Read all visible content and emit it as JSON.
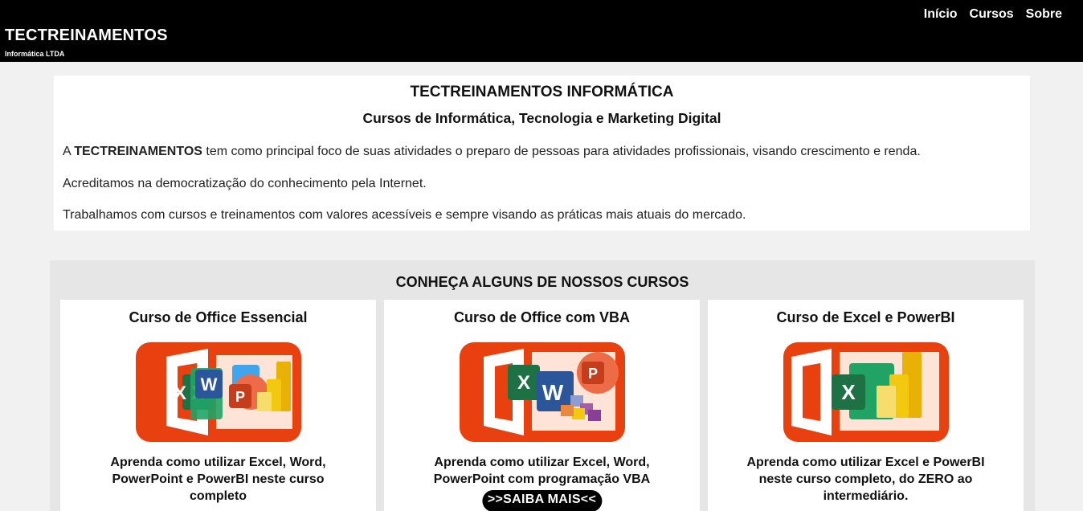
{
  "header": {
    "brand": "TECTREINAMENTOS",
    "brand_sub": "Informática LTDA",
    "nav": [
      "Início",
      "Cursos",
      "Sobre"
    ]
  },
  "intro": {
    "title": "TECTREINAMENTOS INFORMÁTICA",
    "subtitle": "Cursos de Informática, Tecnologia e Marketing Digital",
    "p1_prefix": "A ",
    "p1_bold": "TECTREINAMENTOS",
    "p1_rest": " tem como principal foco de suas atividades o preparo de pessoas para atividades profissionais, visando crescimento e renda.",
    "p2": "Acreditamos na democratização do conhecimento pela Internet.",
    "p3": "Trabalhamos com cursos e treinamentos com valores acessíveis e sempre visando as práticas mais atuais do mercado."
  },
  "courses": {
    "title": "CONHEÇA ALGUNS DE NOSSOS CURSOS",
    "items": [
      {
        "title": "Curso de Office Essencial",
        "desc": "Aprenda como utilizar Excel, Word, PowerPoint e PowerBI neste curso completo",
        "image_icon": "office-essencial-logo"
      },
      {
        "title": "Curso de Office com VBA",
        "desc": "Aprenda como utilizar Excel, Word, PowerPoint com programação VBA",
        "button": ">>SAIBA MAIS<<",
        "image_icon": "office-vba-logo"
      },
      {
        "title": "Curso de Excel e PowerBI",
        "desc": "Aprenda como utilizar Excel e PowerBI neste curso completo, do ZERO ao intermediário.",
        "image_icon": "excel-powerbi-logo"
      }
    ]
  },
  "colors": {
    "header_bg": "#000000",
    "office_orange": "#e8410f",
    "excel_green": "#1e7145",
    "word_blue": "#2b579a",
    "ppt_red": "#c43e1c",
    "powerbi_yellow": "#f2c811"
  }
}
